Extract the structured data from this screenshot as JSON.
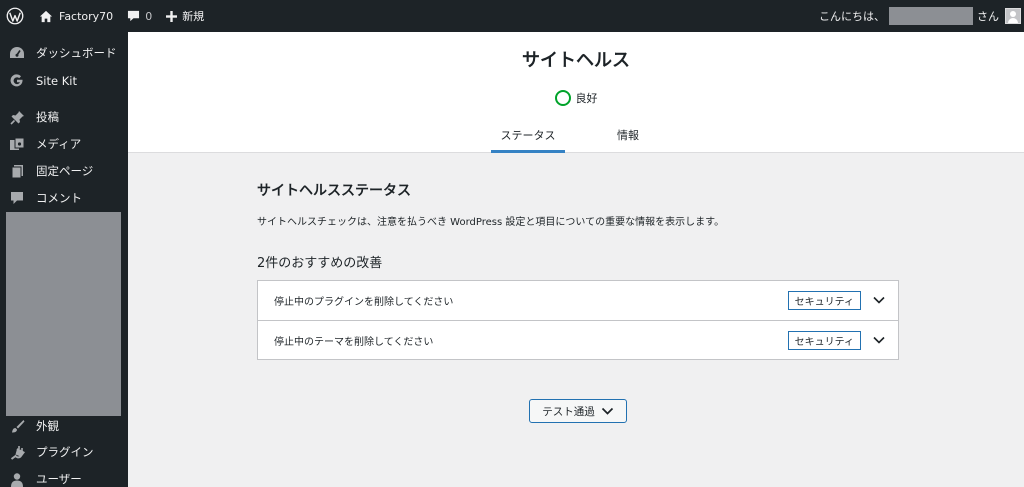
{
  "adminbar": {
    "site_name": "Factory70",
    "comments_count": "0",
    "new_label": "新規",
    "greeting": "こんにちは、",
    "greeting_suffix": "さん"
  },
  "sidebar": {
    "items": [
      {
        "label": "ダッシュボード",
        "icon": "dashboard-icon"
      },
      {
        "label": "Site Kit",
        "icon": "google-g-icon"
      },
      {
        "label": "投稿",
        "icon": "pushpin-icon"
      },
      {
        "label": "メディア",
        "icon": "media-icon"
      },
      {
        "label": "固定ページ",
        "icon": "page-icon"
      },
      {
        "label": "コメント",
        "icon": "comment-icon"
      },
      {
        "label": "外観",
        "icon": "paintbrush-icon"
      },
      {
        "label": "プラグイン",
        "icon": "plugin-icon"
      },
      {
        "label": "ユーザー",
        "icon": "user-icon"
      }
    ]
  },
  "header": {
    "title": "サイトヘルス",
    "score_label": "良好",
    "score_color": "#00a32a",
    "tabs": [
      {
        "label": "ステータス",
        "active": true
      },
      {
        "label": "情報",
        "active": false
      }
    ]
  },
  "main": {
    "section_title": "サイトヘルスステータス",
    "description": "サイトヘルスチェックは、注意を払うべき WordPress 設定と項目についての重要な情報を表示します。",
    "issues_heading": "2件のおすすめの改善",
    "issues": [
      {
        "title": "停止中のプラグインを削除してください",
        "badge": "セキュリティ"
      },
      {
        "title": "停止中のテーマを削除してください",
        "badge": "セキュリティ"
      }
    ],
    "passed_button": "テスト通過"
  },
  "colors": {
    "adminbar_bg": "#1d2327",
    "accent": "#2271b1",
    "tab_underline": "#3582c4"
  }
}
